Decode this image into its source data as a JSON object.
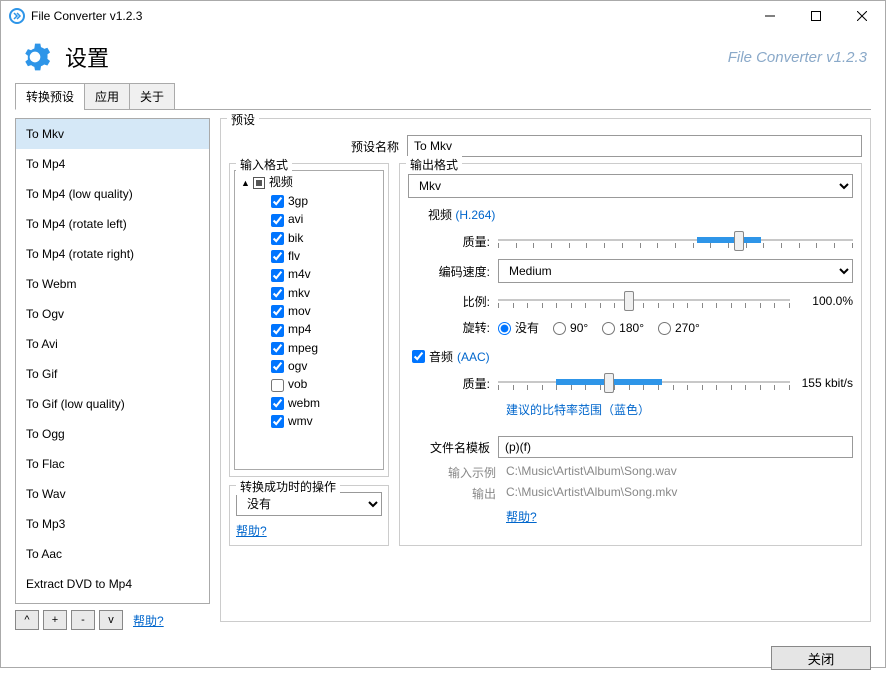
{
  "window": {
    "title": "File Converter v1.2.3",
    "brand": "File Converter v1.2.3"
  },
  "header": {
    "title": "设置"
  },
  "tabs": [
    "转换预设",
    "应用",
    "关于"
  ],
  "presets": [
    "To Mkv",
    "To Mp4",
    "To Mp4 (low quality)",
    "To Mp4 (rotate left)",
    "To Mp4 (rotate right)",
    "To Webm",
    "To Ogv",
    "To Avi",
    "To Gif",
    "To Gif (low quality)",
    "To Ogg",
    "To Flac",
    "To Wav",
    "To Mp3",
    "To Aac",
    "Extract DVD to Mp4"
  ],
  "listButtons": {
    "up": "^",
    "add": "+",
    "remove": "-",
    "down": "v",
    "help": "帮助?"
  },
  "presetPanel": {
    "legend": "预设",
    "nameLabel": "预设名称",
    "nameValue": "To Mkv"
  },
  "inputFormat": {
    "legend": "输入格式",
    "category": "视频",
    "items": [
      {
        "label": "3gp",
        "checked": true
      },
      {
        "label": "avi",
        "checked": true
      },
      {
        "label": "bik",
        "checked": true
      },
      {
        "label": "flv",
        "checked": true
      },
      {
        "label": "m4v",
        "checked": true
      },
      {
        "label": "mkv",
        "checked": true
      },
      {
        "label": "mov",
        "checked": true
      },
      {
        "label": "mp4",
        "checked": true
      },
      {
        "label": "mpeg",
        "checked": true
      },
      {
        "label": "ogv",
        "checked": true
      },
      {
        "label": "vob",
        "checked": false
      },
      {
        "label": "webm",
        "checked": true
      },
      {
        "label": "wmv",
        "checked": true
      }
    ],
    "postActionLabel": "转换成功时的操作",
    "postActionValue": "没有",
    "help": "帮助?"
  },
  "outputFormat": {
    "legend": "输出格式",
    "value": "Mkv",
    "videoTitle": "视频",
    "videoCodec": "(H.264)",
    "qualityLabel": "质量:",
    "qualityPos": 68,
    "qualityFill": [
      56,
      74
    ],
    "encSpeedLabel": "编码速度:",
    "encSpeedValue": "Medium",
    "scaleLabel": "比例:",
    "scalePos": 45,
    "scaleValue": "100.0%",
    "rotateLabel": "旋转:",
    "rotateOptions": [
      "没有",
      "90°",
      "180°",
      "270°"
    ],
    "rotateSelected": 0,
    "audioTitle": "音频",
    "audioCodec": "(AAC)",
    "audioEnabled": true,
    "audioQualityLabel": "质量:",
    "audioQualityPos": 38,
    "audioQualityFill": [
      20,
      56
    ],
    "audioQualityValue": "155 kbit/s",
    "bitrateHint": "建议的比特率范围（蓝色）",
    "templateLabel": "文件名模板",
    "templateValue": "(p)(f)",
    "inputExampleLabel": "输入示例",
    "inputExampleValue": "C:\\Music\\Artist\\Album\\Song.wav",
    "outputExampleLabel": "输出",
    "outputExampleValue": "C:\\Music\\Artist\\Album\\Song.mkv",
    "help": "帮助?"
  },
  "footer": {
    "close": "关闭"
  }
}
